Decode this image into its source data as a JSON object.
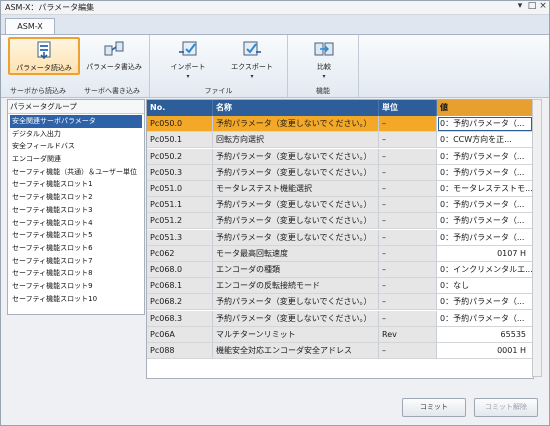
{
  "window": {
    "title": "ASM-X：パラメータ編集"
  },
  "tab": {
    "label": "ASM-X"
  },
  "ribbon": {
    "read_button": "パラメータ読込み",
    "write_button": "パラメータ書込み",
    "group_servo_read": "サーボから読込み",
    "group_servo_write": "サーボへ書き込み",
    "import_button": "インポート",
    "export_button": "エクスポート",
    "group_file": "ファイル",
    "compare_button": "比較",
    "group_function": "機能",
    "dropdown_glyph": "▾"
  },
  "sidebar": {
    "header": "パラメータグループ",
    "items": [
      "安全関連サーボパラメータ",
      "デジタル入出力",
      "安全フィールドバス",
      "エンコーダ関連",
      "セーフティ機能（共通）＆ユーザー単位",
      "セーフティ機能スロット1",
      "セーフティ機能スロット2",
      "セーフティ機能スロット3",
      "セーフティ機能スロット4",
      "セーフティ機能スロット5",
      "セーフティ機能スロット6",
      "セーフティ機能スロット7",
      "セーフティ機能スロット8",
      "セーフティ機能スロット9",
      "セーフティ機能スロット10"
    ]
  },
  "grid": {
    "headers": {
      "no": "No.",
      "name": "名称",
      "unit": "単位",
      "value": "値"
    },
    "rows": [
      {
        "no": "Pc050.0",
        "name": "予約パラメータ（変更しないでください。）",
        "unit": "–",
        "value": "0：予約パラメータ（..."
      },
      {
        "no": "Pc050.1",
        "name": "回転方向選択",
        "unit": "–",
        "value": "0：CCW方向を正..."
      },
      {
        "no": "Pc050.2",
        "name": "予約パラメータ（変更しないでください。）",
        "unit": "–",
        "value": "0：予約パラメータ（..."
      },
      {
        "no": "Pc050.3",
        "name": "予約パラメータ（変更しないでください。）",
        "unit": "–",
        "value": "0：予約パラメータ（..."
      },
      {
        "no": "Pc051.0",
        "name": "モータレステスト機能選択",
        "unit": "–",
        "value": "0：モータレステストモ..."
      },
      {
        "no": "Pc051.1",
        "name": "予約パラメータ（変更しないでください。）",
        "unit": "–",
        "value": "0：予約パラメータ（..."
      },
      {
        "no": "Pc051.2",
        "name": "予約パラメータ（変更しないでください。）",
        "unit": "–",
        "value": "0：予約パラメータ（..."
      },
      {
        "no": "Pc051.3",
        "name": "予約パラメータ（変更しないでください。）",
        "unit": "–",
        "value": "0：予約パラメータ（..."
      },
      {
        "no": "Pc062",
        "name": "モータ最高回転速度",
        "unit": "–",
        "value": "0107 H"
      },
      {
        "no": "Pc068.0",
        "name": "エンコーダの種類",
        "unit": "–",
        "value": "0：インクリメンタルエ..."
      },
      {
        "no": "Pc068.1",
        "name": "エンコーダの反転接続モード",
        "unit": "–",
        "value": "0：なし"
      },
      {
        "no": "Pc068.2",
        "name": "予約パラメータ（変更しないでください。）",
        "unit": "–",
        "value": "0：予約パラメータ（..."
      },
      {
        "no": "Pc068.3",
        "name": "予約パラメータ（変更しないでください。）",
        "unit": "–",
        "value": "0：予約パラメータ（..."
      },
      {
        "no": "Pc06A",
        "name": "マルチターンリミット",
        "unit": "Rev",
        "value": "65535"
      },
      {
        "no": "Pc088",
        "name": "機能安全対応エンコーダ安全アドレス",
        "unit": "–",
        "value": "0001 H"
      }
    ]
  },
  "footer": {
    "commit_button": "コミット",
    "uncommit_button": "コミット解除"
  },
  "colors": {
    "header_blue": "#2d5e99",
    "selected_orange": "#f3a828",
    "value_header": "#e7a030"
  }
}
